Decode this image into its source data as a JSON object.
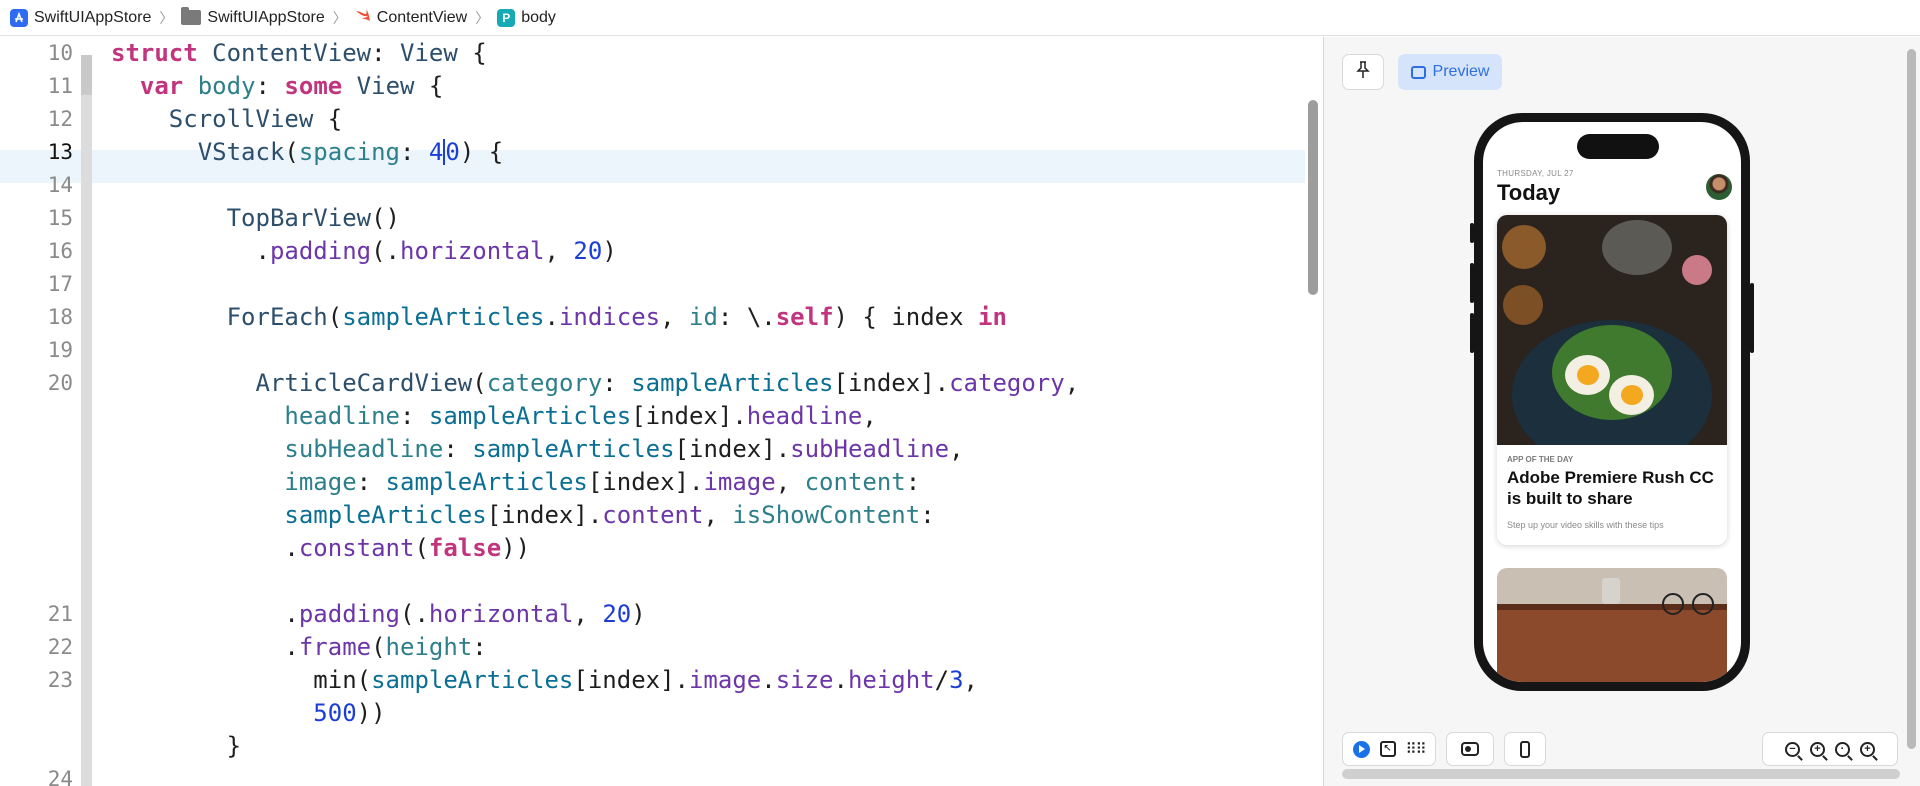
{
  "breadcrumb": {
    "project": "SwiftUIAppStore",
    "folder": "SwiftUIAppStore",
    "file": "ContentView",
    "symbol": "body",
    "symbol_badge": "P"
  },
  "editor": {
    "current_line": 13,
    "line_numbers": [
      "10",
      "11",
      "12",
      "13",
      "14",
      "15",
      "16",
      "17",
      "18",
      "19",
      "20",
      "21",
      "22",
      "23",
      "24"
    ],
    "code": [
      "struct ContentView: View {",
      "var body: some View {",
      "ScrollView {",
      "VStack(spacing: 40) {",
      "",
      "TopBarView()",
      ".padding(.horizontal, 20)",
      "",
      "ForEach(sampleArticles.indices, id: \\.self) { index in",
      "",
      "ArticleCardView(category: sampleArticles[index].category,",
      "headline: sampleArticles[index].headline,",
      "subHeadline: sampleArticles[index].subHeadline,",
      "image: sampleArticles[index].image, content:",
      "sampleArticles[index].content, isShowContent:",
      ".constant(false))",
      "",
      ".padding(.horizontal, 20)",
      ".frame(height:",
      "min(sampleArticles[index].image.size.height/3,",
      "500))",
      "}"
    ]
  },
  "canvas": {
    "preview_label": "Preview",
    "pin_icon": "pin-icon",
    "app": {
      "date": "THURSDAY, JUL 27",
      "title": "Today",
      "card": {
        "category": "APP OF THE DAY",
        "headline": "Adobe Premiere Rush CC is built to share",
        "subheadline": "Step up your video skills with these tips"
      }
    },
    "toolbar": {
      "live_icon": "play-icon",
      "select_icon": "select-icon",
      "variants_icon": "grid-icon",
      "settings_icon": "toggle-icon",
      "device_icon": "device-icon",
      "zoom_icons": [
        "zoom-out-icon",
        "zoom-in-icon",
        "zoom-fit-icon",
        "zoom-actual-icon"
      ]
    }
  }
}
